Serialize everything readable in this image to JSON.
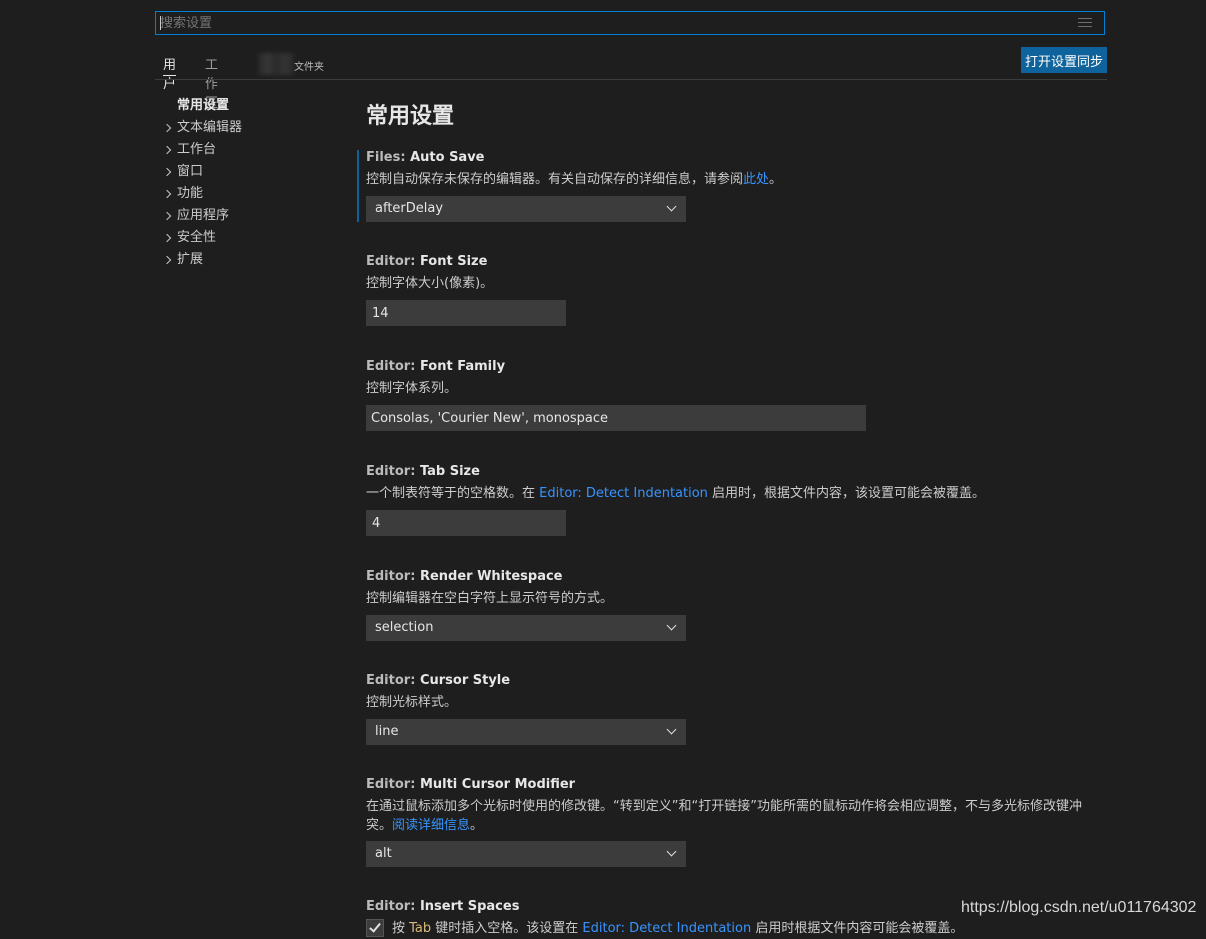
{
  "search": {
    "placeholder": "搜索设置"
  },
  "tabs": {
    "user": "用户",
    "workspace": "工作区",
    "folder": "文件夹"
  },
  "sync_button": "打开设置同步",
  "toc": {
    "heading": "常用设置",
    "items": [
      "文本编辑器",
      "工作台",
      "窗口",
      "功能",
      "应用程序",
      "安全性",
      "扩展"
    ]
  },
  "main": {
    "title": "常用设置",
    "settings": [
      {
        "category": "Files: ",
        "name": "Auto Save",
        "desc": "控制自动保存未保存的编辑器。有关自动保存的详细信息，请参阅",
        "desc_link": "此处",
        "desc_tail": "。",
        "value": "afterDelay"
      },
      {
        "category": "Editor: ",
        "name": "Font Size",
        "desc": "控制字体大小(像素)。",
        "value": "14"
      },
      {
        "category": "Editor: ",
        "name": "Font Family",
        "desc": "控制字体系列。",
        "value": "Consolas, 'Courier New', monospace"
      },
      {
        "category": "Editor: ",
        "name": "Tab Size",
        "desc": "一个制表符等于的空格数。在 ",
        "desc_link": "Editor: Detect Indentation",
        "desc_tail": " 启用时，根据文件内容，该设置可能会被覆盖。",
        "value": "4"
      },
      {
        "category": "Editor: ",
        "name": "Render Whitespace",
        "desc": "控制编辑器在空白字符上显示符号的方式。",
        "value": "selection"
      },
      {
        "category": "Editor: ",
        "name": "Cursor Style",
        "desc": "控制光标样式。",
        "value": "line"
      },
      {
        "category": "Editor: ",
        "name": "Multi Cursor Modifier",
        "desc_line1": "在通过鼠标添加多个光标时使用的修改键。“转到定义”和“打开链接”功能所需的鼠标动作将会相应调整，不与多光标修改键冲",
        "desc_line2": "突。",
        "desc_link": "阅读详细信息",
        "desc_tail": "。",
        "value": "alt"
      },
      {
        "category": "Editor: ",
        "name": "Insert Spaces",
        "desc_pre": "按 ",
        "desc_code": "Tab",
        "desc_mid": " 键时插入空格。该设置在 ",
        "desc_link": "Editor: Detect Indentation",
        "desc_tail": " 启用时根据文件内容可能会被覆盖。",
        "checked": true
      }
    ]
  },
  "watermark": "https://blog.csdn.net/u011764302",
  "colors": {
    "background": "#1e1e1e",
    "accent": "#0e639c",
    "focus_border": "#007fd4",
    "link": "#3794ff",
    "input_bg": "#3c3c3c"
  }
}
